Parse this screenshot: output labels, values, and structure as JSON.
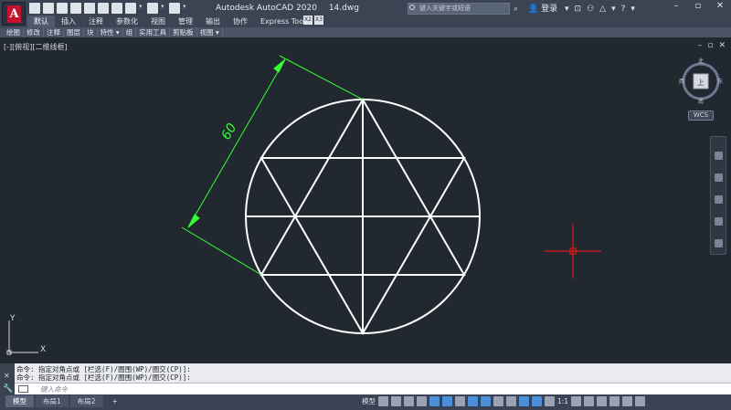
{
  "app": {
    "title": "Autodesk AutoCAD 2020",
    "file": "14.dwg",
    "search_placeholder": "键入关键字或短语",
    "login": "登录"
  },
  "tabs": [
    "默认",
    "插入",
    "注释",
    "参数化",
    "视图",
    "管理",
    "输出",
    "协作",
    "Express Tools"
  ],
  "mini_labels": [
    "X2",
    "X3"
  ],
  "panels": [
    "绘图",
    "修改",
    "注释",
    "图层",
    "块",
    "特性 ▾",
    "组",
    "实用工具",
    "剪贴板",
    "视图 ▾"
  ],
  "viewport": {
    "label": "[-][俯视][二维线框]",
    "dimension_text": "60",
    "wcs": "WCS",
    "viewcube": {
      "north": "北",
      "south": "南",
      "east": "东",
      "west": "西",
      "face": "上"
    },
    "ucs": {
      "x": "X",
      "y": "Y"
    }
  },
  "command": {
    "line1": "命令: 指定对角点或 [栏选(F)/圈围(WP)/圈交(CP)]:",
    "line2": "命令: 指定对角点或 [栏选(F)/圈围(WP)/圈交(CP)]:",
    "placeholder": "键入命令"
  },
  "status": {
    "layout_tabs": [
      "模型",
      "布局1",
      "布局2",
      "+"
    ],
    "model_label": "模型",
    "scale": "1:1"
  },
  "colors": {
    "background": "#212830",
    "geometry": "#ffffff",
    "dimension": "#33ff33",
    "crosshair": "#e01818",
    "accent": "#4a8fd8"
  }
}
